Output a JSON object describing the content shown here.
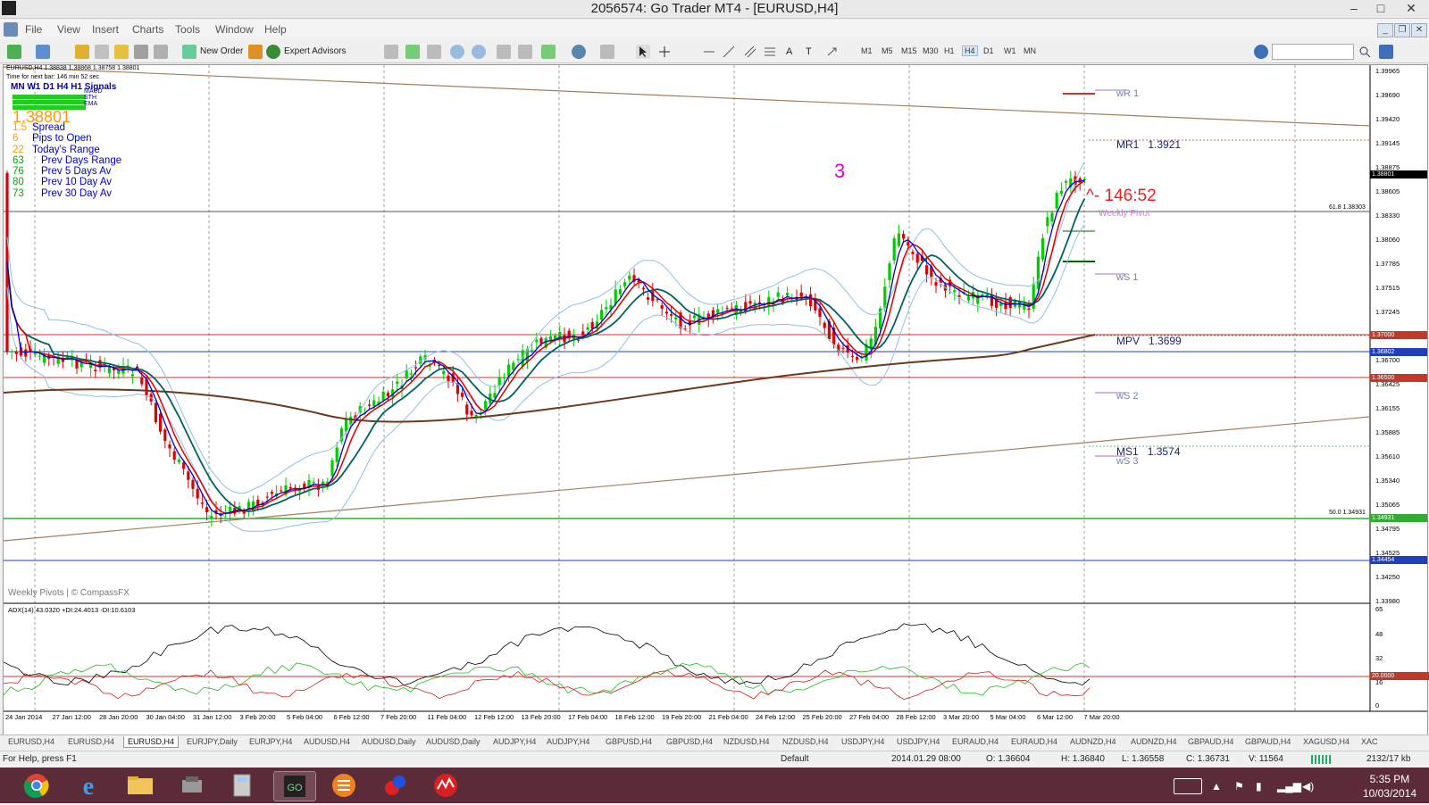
{
  "window": {
    "title": "2056574: Go Trader MT4 - [EURUSD,H4]",
    "min": "–",
    "max": "□",
    "close": "✕"
  },
  "menu": [
    "File",
    "View",
    "Insert",
    "Charts",
    "Tools",
    "Window",
    "Help"
  ],
  "toolbar": {
    "new_order": "New Order",
    "expert_advisors": "Expert Advisors",
    "timeframes": [
      "M1",
      "M5",
      "M15",
      "M30",
      "H1",
      "H4",
      "D1",
      "W1",
      "MN"
    ],
    "active_timeframe": "H4"
  },
  "chart": {
    "symbol_header": "EURUSD,H4  1.38838 1.38868 1.38758 1.38801",
    "time_next_bar": "Time for next bar: 146 min 52 sec",
    "signals_label": "MN W1 D1  H4  H1  Signals",
    "macd": "MACD",
    "sth": "STH",
    "ema": "EMA",
    "price_big": "1.38801",
    "stats": [
      {
        "value": "1.5",
        "label": "Spread"
      },
      {
        "value": "6",
        "label": "Pips to Open"
      },
      {
        "value": "22",
        "label": "Today's Range"
      },
      {
        "value": "63",
        "label": "Prev Days Range"
      },
      {
        "value": "76",
        "label": "Prev 5 Days Av"
      },
      {
        "value": "80",
        "label": "Prev 10 Day Av"
      },
      {
        "value": "73",
        "label": "Prev 30 Day Av"
      }
    ],
    "annotation_3": "3",
    "countdown": "^- 146:52",
    "weekly_pivot": "Weekly Pivot",
    "pivots": {
      "wr1": "wR 1",
      "mr1": "MR1",
      "mr1_val": "1.3921",
      "ws1": "wS 1",
      "mpv": "MPV",
      "mpv_val": "1.3699",
      "ws2": "wS 2",
      "ms1": "MS1",
      "ms1_val": "1.3574",
      "ws3": "wS 3"
    },
    "fib_618": "61.8 1.38303",
    "fib_50": "50.0 1.34931",
    "copyright": "Weekly Pivots | © CompassFX",
    "price_axis": [
      "1.39965",
      "1.39690",
      "1.39420",
      "1.39145",
      "1.38875",
      "1.38605",
      "1.38330",
      "1.38060",
      "1.37785",
      "1.37515",
      "1.37245",
      "1.36970",
      "1.36700",
      "1.36425",
      "1.36155",
      "1.35885",
      "1.35610",
      "1.35340",
      "1.35065",
      "1.34795",
      "1.34525",
      "1.34250",
      "1.33980"
    ],
    "price_tags": [
      {
        "text": "1.38801",
        "bg": "#000000"
      },
      {
        "text": "1.37000",
        "bg": "#c0392b"
      },
      {
        "text": "1.36802",
        "bg": "#1f3fbf"
      },
      {
        "text": "1.36500",
        "bg": "#c0392b"
      },
      {
        "text": "1.34931",
        "bg": "#33aa33"
      },
      {
        "text": "1.34454",
        "bg": "#1f3fbf"
      }
    ],
    "adx_header": "ADX(14) 43.0320 +DI:24.4013 -DI:10.6103",
    "adx_axis": [
      "65",
      "48",
      "32",
      "16",
      "0"
    ],
    "adx_tag": "20.0000",
    "time_axis": [
      "24 Jan 2014",
      "27 Jan 12:00",
      "28 Jan 20:00",
      "30 Jan 04:00",
      "31 Jan 12:00",
      "3 Feb 20:00",
      "5 Feb 04:00",
      "6 Feb 12:00",
      "7 Feb 20:00",
      "11 Feb 04:00",
      "12 Feb 12:00",
      "13 Feb 20:00",
      "17 Feb 04:00",
      "18 Feb 12:00",
      "19 Feb 20:00",
      "21 Feb 04:00",
      "24 Feb 12:00",
      "25 Feb 20:00",
      "27 Feb 04:00",
      "28 Feb 12:00",
      "3 Mar 20:00",
      "5 Mar 04:00",
      "6 Mar 12:00",
      "7 Mar 20:00"
    ]
  },
  "tabs": [
    "EURUSD,H4",
    "EURUSD,H4",
    "EURUSD,H4",
    "EURJPY,Daily",
    "EURJPY,H4",
    "AUDUSD,H4",
    "AUDUSD,Daily",
    "AUDUSD,Daily",
    "AUDJPY,H4",
    "AUDJPY,H4",
    "GBPUSD,H4",
    "GBPUSD,H4",
    "NZDUSD,H4",
    "NZDUSD,H4",
    "USDJPY,H4",
    "USDJPY,H4",
    "EURAUD,H4",
    "EURAUD,H4",
    "AUDNZD,H4",
    "AUDNZD,H4",
    "GBPAUD,H4",
    "GBPAUD,H4",
    "XAGUSD,H4",
    "XAC"
  ],
  "active_tab": 2,
  "status": {
    "help": "For Help, press F1",
    "profile": "Default",
    "datetime": "2014.01.29 08:00",
    "open": "O: 1.36604",
    "high": "H: 1.36840",
    "low": "L: 1.36558",
    "close": "C: 1.36731",
    "volume": "V: 11564",
    "traffic": "2132/17 kb"
  },
  "taskbar": {
    "time": "5:35 PM",
    "date": "10/03/2014"
  },
  "colors": {
    "bull": "#00cc00",
    "bear": "#dd0000",
    "ema_fast": "#0000cc",
    "ema_mid": "#dd0000",
    "ema_slow": "#006060",
    "ma_long": "#6b3a1e",
    "bollinger": "#90c0e0",
    "pivot_red": "#c0392b",
    "pivot_blue": "#1f3fbf",
    "fib_green": "#33aa33"
  }
}
